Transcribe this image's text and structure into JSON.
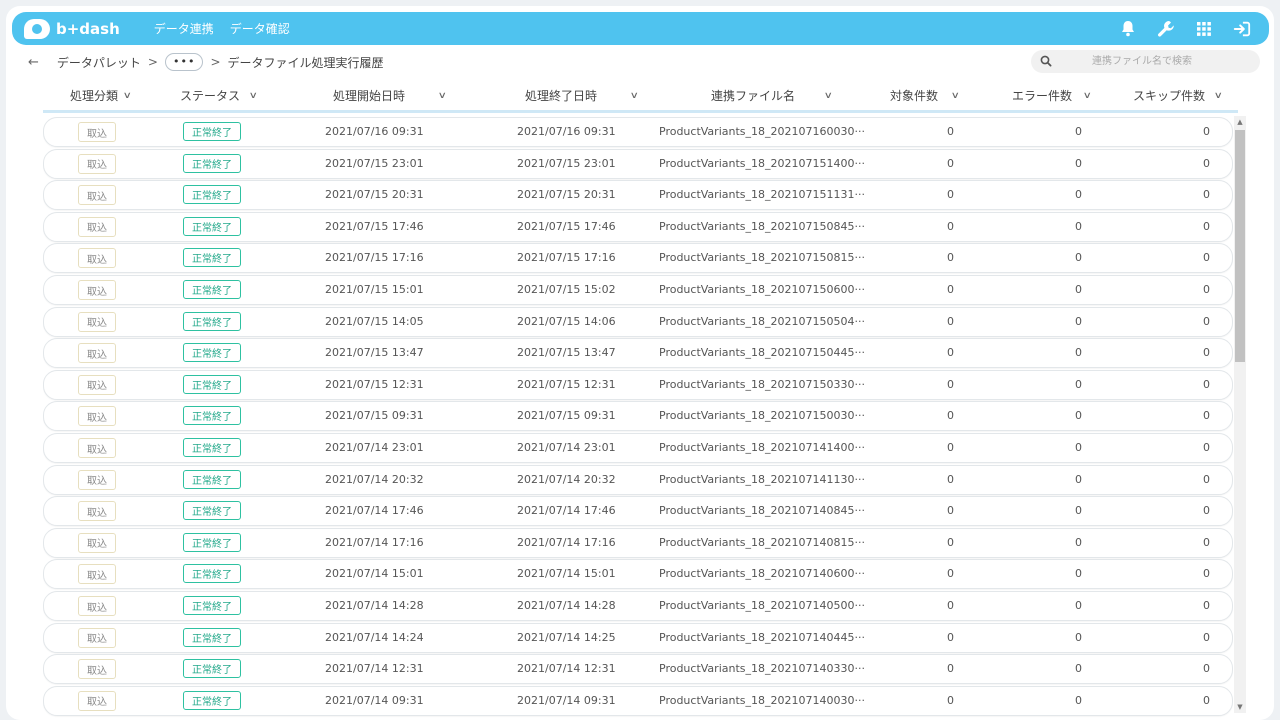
{
  "app": {
    "logo_text": "b+dash"
  },
  "nav": {
    "items": [
      {
        "label": "データ連携"
      },
      {
        "label": "データ確認"
      }
    ]
  },
  "top_icons": [
    "bell-icon",
    "wrench-icon",
    "grid-icon",
    "logout-icon"
  ],
  "breadcrumb": {
    "back_icon": "arrow-left-icon",
    "root": "データパレット",
    "ellipsis": "•••",
    "current": "データファイル処理実行履歴",
    "separator": ">"
  },
  "search": {
    "placeholder": "連携ファイル名で検索",
    "value": ""
  },
  "columns": [
    {
      "label": "処理分類"
    },
    {
      "label": "ステータス"
    },
    {
      "label": "処理開始日時"
    },
    {
      "label": "処理終了日時"
    },
    {
      "label": "連携ファイル名"
    },
    {
      "label": "対象件数"
    },
    {
      "label": "エラー件数"
    },
    {
      "label": "スキップ件数"
    }
  ],
  "rows": [
    {
      "type": "取込",
      "status": "正常終了",
      "start": "2021/07/16 09:31",
      "end": "2021/07/16 09:31",
      "file": "ProductVariants_18_202107160030···",
      "target": "0",
      "errors": "0",
      "skips": "0"
    },
    {
      "type": "取込",
      "status": "正常終了",
      "start": "2021/07/15 23:01",
      "end": "2021/07/15 23:01",
      "file": "ProductVariants_18_202107151400···",
      "target": "0",
      "errors": "0",
      "skips": "0"
    },
    {
      "type": "取込",
      "status": "正常終了",
      "start": "2021/07/15 20:31",
      "end": "2021/07/15 20:31",
      "file": "ProductVariants_18_202107151131···",
      "target": "0",
      "errors": "0",
      "skips": "0"
    },
    {
      "type": "取込",
      "status": "正常終了",
      "start": "2021/07/15 17:46",
      "end": "2021/07/15 17:46",
      "file": "ProductVariants_18_202107150845···",
      "target": "0",
      "errors": "0",
      "skips": "0"
    },
    {
      "type": "取込",
      "status": "正常終了",
      "start": "2021/07/15 17:16",
      "end": "2021/07/15 17:16",
      "file": "ProductVariants_18_202107150815···",
      "target": "0",
      "errors": "0",
      "skips": "0"
    },
    {
      "type": "取込",
      "status": "正常終了",
      "start": "2021/07/15 15:01",
      "end": "2021/07/15 15:02",
      "file": "ProductVariants_18_202107150600···",
      "target": "0",
      "errors": "0",
      "skips": "0"
    },
    {
      "type": "取込",
      "status": "正常終了",
      "start": "2021/07/15 14:05",
      "end": "2021/07/15 14:06",
      "file": "ProductVariants_18_202107150504···",
      "target": "0",
      "errors": "0",
      "skips": "0"
    },
    {
      "type": "取込",
      "status": "正常終了",
      "start": "2021/07/15 13:47",
      "end": "2021/07/15 13:47",
      "file": "ProductVariants_18_202107150445···",
      "target": "0",
      "errors": "0",
      "skips": "0"
    },
    {
      "type": "取込",
      "status": "正常終了",
      "start": "2021/07/15 12:31",
      "end": "2021/07/15 12:31",
      "file": "ProductVariants_18_202107150330···",
      "target": "0",
      "errors": "0",
      "skips": "0"
    },
    {
      "type": "取込",
      "status": "正常終了",
      "start": "2021/07/15 09:31",
      "end": "2021/07/15 09:31",
      "file": "ProductVariants_18_202107150030···",
      "target": "0",
      "errors": "0",
      "skips": "0"
    },
    {
      "type": "取込",
      "status": "正常終了",
      "start": "2021/07/14 23:01",
      "end": "2021/07/14 23:01",
      "file": "ProductVariants_18_202107141400···",
      "target": "0",
      "errors": "0",
      "skips": "0"
    },
    {
      "type": "取込",
      "status": "正常終了",
      "start": "2021/07/14 20:32",
      "end": "2021/07/14 20:32",
      "file": "ProductVariants_18_202107141130···",
      "target": "0",
      "errors": "0",
      "skips": "0"
    },
    {
      "type": "取込",
      "status": "正常終了",
      "start": "2021/07/14 17:46",
      "end": "2021/07/14 17:46",
      "file": "ProductVariants_18_202107140845···",
      "target": "0",
      "errors": "0",
      "skips": "0"
    },
    {
      "type": "取込",
      "status": "正常終了",
      "start": "2021/07/14 17:16",
      "end": "2021/07/14 17:16",
      "file": "ProductVariants_18_202107140815···",
      "target": "0",
      "errors": "0",
      "skips": "0"
    },
    {
      "type": "取込",
      "status": "正常終了",
      "start": "2021/07/14 15:01",
      "end": "2021/07/14 15:01",
      "file": "ProductVariants_18_202107140600···",
      "target": "0",
      "errors": "0",
      "skips": "0"
    },
    {
      "type": "取込",
      "status": "正常終了",
      "start": "2021/07/14 14:28",
      "end": "2021/07/14 14:28",
      "file": "ProductVariants_18_202107140500···",
      "target": "0",
      "errors": "0",
      "skips": "0"
    },
    {
      "type": "取込",
      "status": "正常終了",
      "start": "2021/07/14 14:24",
      "end": "2021/07/14 14:25",
      "file": "ProductVariants_18_202107140445···",
      "target": "0",
      "errors": "0",
      "skips": "0"
    },
    {
      "type": "取込",
      "status": "正常終了",
      "start": "2021/07/14 12:31",
      "end": "2021/07/14 12:31",
      "file": "ProductVariants_18_202107140330···",
      "target": "0",
      "errors": "0",
      "skips": "0"
    },
    {
      "type": "取込",
      "status": "正常終了",
      "start": "2021/07/14 09:31",
      "end": "2021/07/14 09:31",
      "file": "ProductVariants_18_202107140030···",
      "target": "0",
      "errors": "0",
      "skips": "0"
    }
  ],
  "colors": {
    "brand": "#4fc3ef",
    "status_ok": "#2ec1a1",
    "type_border": "#e7dfbf"
  }
}
